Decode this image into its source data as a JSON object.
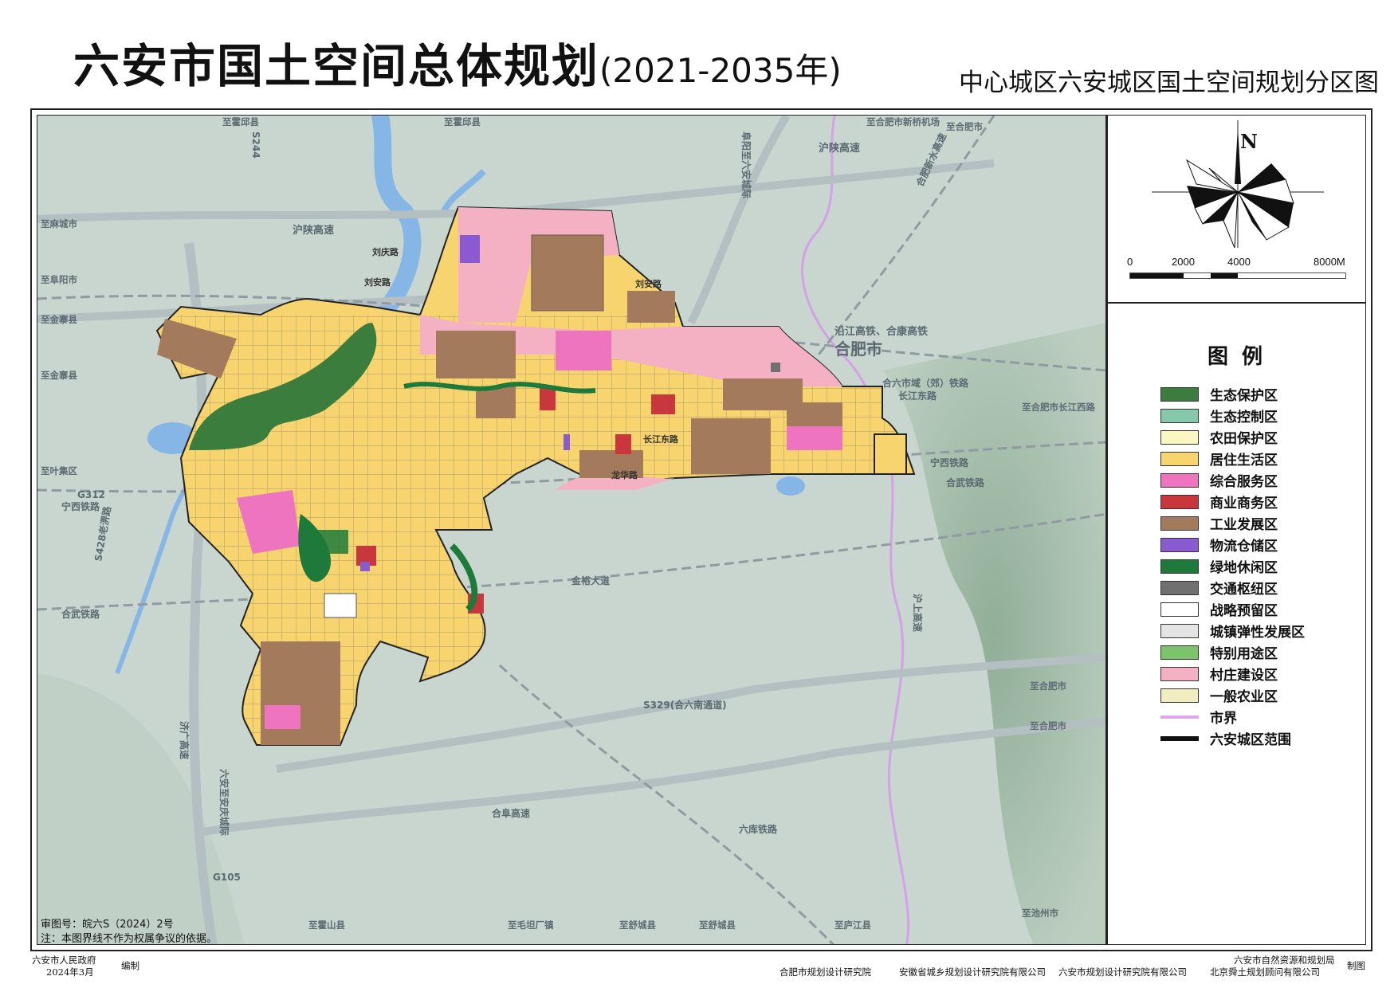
{
  "title": {
    "main": "六安市国土空间总体规划",
    "period": "(2021-2035年)",
    "right": "中心城区六安城区国土空间规划分区图"
  },
  "map": {
    "city_label": "合肥市",
    "roads": {
      "hushan": "沪陕高速",
      "hushan2": "沪陕高速",
      "yanjiang": "沿江高铁、合康高铁",
      "heliu_rail": "合六市域（郊）铁路",
      "changjiang_east": "长江东路",
      "ningxi_rail": "宁西铁路",
      "ningxi_rail2": "宁西铁路",
      "hewu_rail": "合武铁路",
      "hewu_rail2": "合武铁路",
      "g312": "G312",
      "s428": "S428老淠路",
      "jinyu": "金裕大道",
      "s329": "S329(合六南通道)",
      "hehe_expressway": "合肥新水高速",
      "fuyang_liuan": "阜阳至六安城际",
      "liuan_anqing": "六安至安庆城际",
      "jigang": "济广高速",
      "hefu": "合阜高速",
      "liujing": "六库铁路",
      "huhe": "沪上高速",
      "s244": "S244",
      "g105": "G105",
      "liuan_road": "刘安路",
      "liuan_road2": "刘安路",
      "liuqing": "刘庆路",
      "changjiang": "长江东路",
      "longhe": "龙华路"
    },
    "edge_labels": {
      "top_1": "至霍邱县",
      "top_2": "至霍邱县",
      "top_right_airport": "至合肥市新桥机场",
      "top_right": "至合肥市",
      "left_1": "至麻城市",
      "left_2": "至阜阳市",
      "left_3": "至金寨县",
      "left_4": "至金寨县",
      "left_5": "至叶集区",
      "right_1": "至合肥市长江西路",
      "right_2": "至合肥市",
      "right_3": "至合肥市",
      "bottom_1": "至霍山县",
      "bottom_2": "至毛坦厂镇",
      "bottom_3": "至舒城县",
      "bottom_4": "至舒城县",
      "bottom_5": "至庐江县",
      "bottom_6": "至池州市"
    },
    "note_number": "审图号：皖六S（2024）2号",
    "note_disclaimer": "注：本图界线不作为权属争议的依据。"
  },
  "compass": {
    "north": "N",
    "scale": [
      "0",
      "2000",
      "4000",
      "8000M"
    ]
  },
  "legend": {
    "title": "图 例",
    "items": [
      {
        "label": "生态保护区",
        "color": "#3a7d3c",
        "type": "fill"
      },
      {
        "label": "生态控制区",
        "color": "#86c8aa",
        "type": "fill"
      },
      {
        "label": "农田保护区",
        "color": "#fbf7c0",
        "type": "fill"
      },
      {
        "label": "居住生活区",
        "color": "#f8d46e",
        "type": "fill"
      },
      {
        "label": "综合服务区",
        "color": "#ee74c0",
        "type": "fill"
      },
      {
        "label": "商业商务区",
        "color": "#c8373b",
        "type": "fill"
      },
      {
        "label": "工业发展区",
        "color": "#a47a5c",
        "type": "fill"
      },
      {
        "label": "物流仓储区",
        "color": "#8a5bd0",
        "type": "fill"
      },
      {
        "label": "绿地休闲区",
        "color": "#1e7a3a",
        "type": "fill"
      },
      {
        "label": "交通枢纽区",
        "color": "#707070",
        "type": "fill"
      },
      {
        "label": "战略预留区",
        "color": "#ffffff",
        "type": "fill"
      },
      {
        "label": "城镇弹性发展区",
        "color": "#e4e4e4",
        "type": "fill"
      },
      {
        "label": "特别用途区",
        "color": "#7cc46b",
        "type": "fill"
      },
      {
        "label": "村庄建设区",
        "color": "#f3b1c3",
        "type": "fill"
      },
      {
        "label": "一般农业区",
        "color": "#f1edbf",
        "type": "fill"
      },
      {
        "label": "市界",
        "color": "#e2a6ea",
        "type": "line-pink"
      },
      {
        "label": "六安城区范围",
        "color": "#111111",
        "type": "line-black"
      }
    ]
  },
  "footer": {
    "gov": "六安市人民政府",
    "date": "2024年3月",
    "compiled": "编制",
    "org1": "合肥市规划设计研究院",
    "org2": "安徽省城乡规划设计研究院有限公司",
    "org3": "六安市规划设计研究院有限公司",
    "org4": "六安市自然资源和规划局",
    "org5": "北京舜土规划顾问有限公司",
    "made": "制图"
  }
}
